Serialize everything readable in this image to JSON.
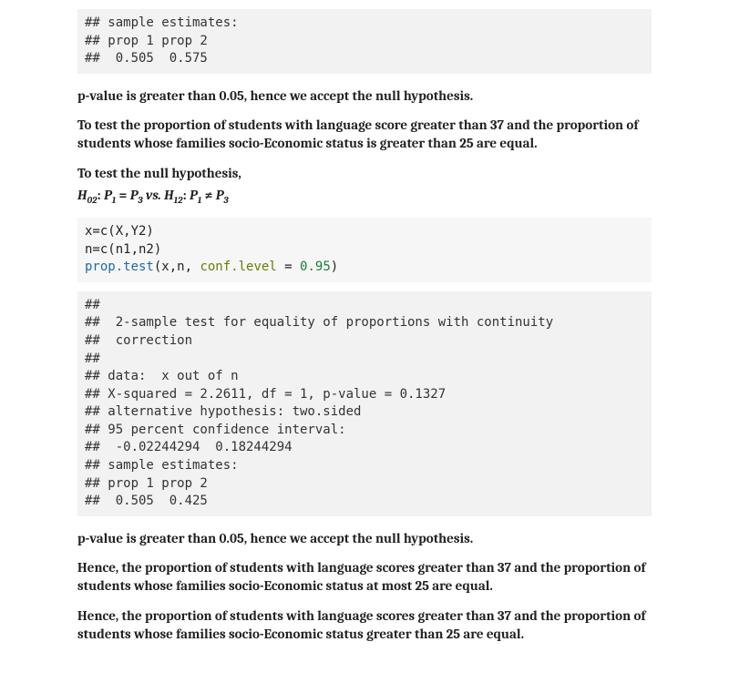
{
  "out1": {
    "l1": "## sample estimates:",
    "l2": "## prop 1 prop 2",
    "l3": "##  0.505  0.575"
  },
  "p1": "p-value is greater than 0.05, hence we accept the null hypothesis.",
  "p2": "To test the proportion of students with language score greater than 37 and the proportion of students whose families socio-Economic status is greater than 25 are equal.",
  "p3": "To test the null hypothesis,",
  "hyp": {
    "h02_lhs": "H",
    "h02_sub": "02",
    "colon": ": ",
    "p1": "P",
    "one": "1",
    "eq": " = ",
    "p3": "P",
    "three": "3",
    "vs": "   vs.   ",
    "h12_lhs": "H",
    "h12_sub": "12",
    "ne": " ≠ "
  },
  "code2": {
    "l1": "x=c(X,Y2)",
    "l2": "n=c(n1,n2)",
    "l3_a": "prop.test",
    "l3_b": "(x,n, ",
    "l3_c": "conf.level",
    "l3_d": " = ",
    "l3_e": "0.95",
    "l3_f": ")"
  },
  "out2": {
    "l1": "##",
    "l2": "##  2-sample test for equality of proportions with continuity",
    "l3": "##  correction",
    "l4": "##",
    "l5": "## data:  x out of n",
    "l6": "## X-squared = 2.2611, df = 1, p-value = 0.1327",
    "l7": "## alternative hypothesis: two.sided",
    "l8": "## 95 percent confidence interval:",
    "l9": "##  -0.02244294  0.18244294",
    "l10": "## sample estimates:",
    "l11": "## prop 1 prop 2",
    "l12": "##  0.505  0.425"
  },
  "p4": "p-value is greater than 0.05, hence we accept the null hypothesis.",
  "p5": "Hence, the proportion of students with language scores greater than 37 and the proportion of students whose families socio-Economic status at most 25 are equal.",
  "p6": "Hence, the proportion of students with language scores greater than 37 and the proportion of students whose families socio-Economic status greater than 25 are equal."
}
